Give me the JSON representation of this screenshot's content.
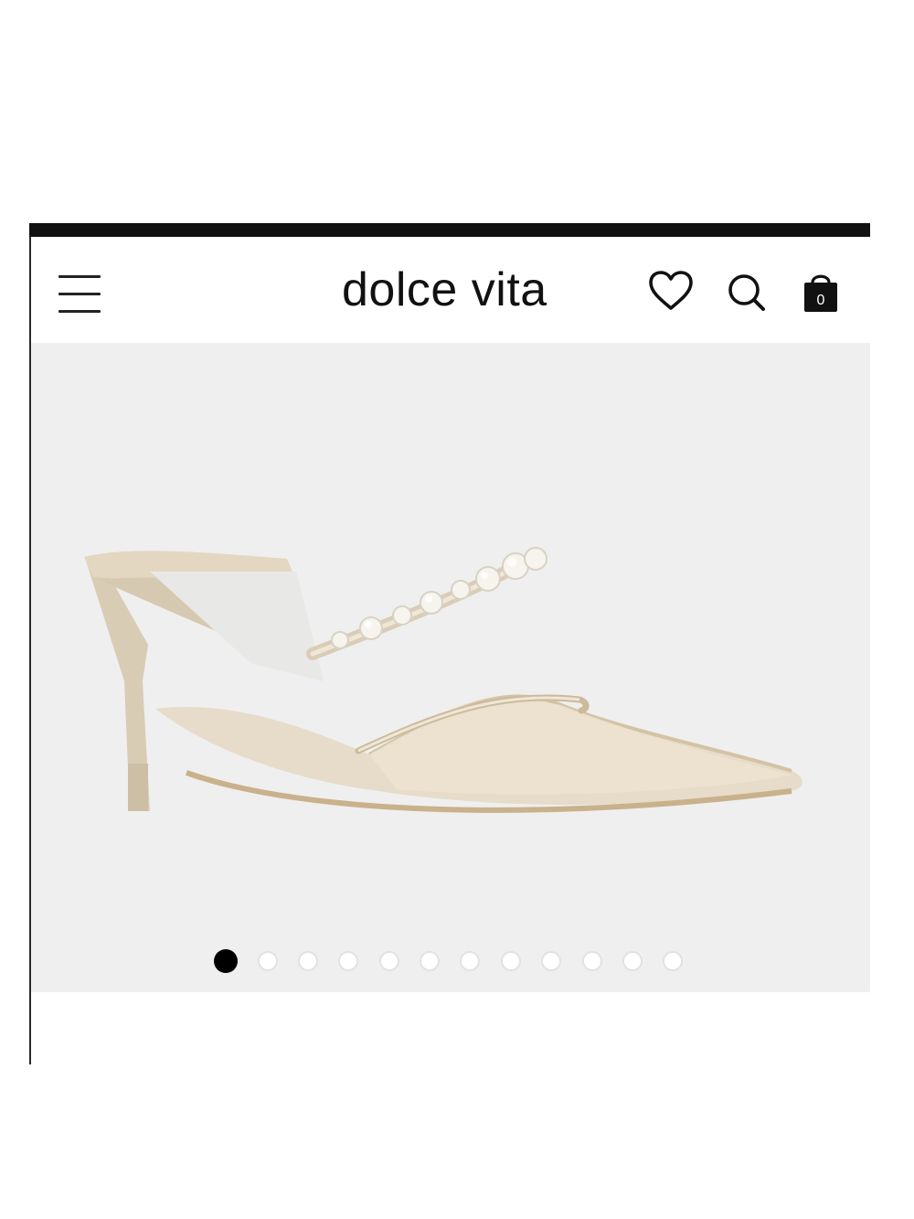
{
  "header": {
    "logo_text": "dolce vita",
    "menu_icon": "hamburger-menu-icon",
    "wishlist_icon": "heart-icon",
    "search_icon": "search-icon",
    "cart_icon": "shopping-bag-icon",
    "cart_count": "0"
  },
  "hero": {
    "image": "pearl-strap-mesh-pointed-toe-mule-heel",
    "background_color": "#efefef",
    "carousel": {
      "total_slides": 12,
      "active_slide": 1
    }
  },
  "colors": {
    "top_bar": "#111111",
    "text": "#111111",
    "active_dot": "#000000",
    "inactive_dot": "#ffffff"
  }
}
